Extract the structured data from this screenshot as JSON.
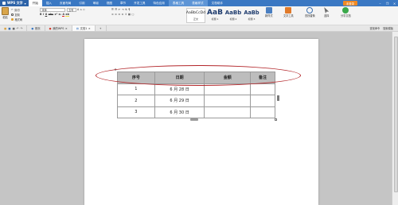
{
  "app": {
    "name": "WPS 文字"
  },
  "menu": {
    "tabs": [
      "开始",
      "插入",
      "页面布局",
      "引用",
      "审阅",
      "视图",
      "章节",
      "开发工具",
      "特色应用"
    ],
    "contextual_tabs": [
      "表格工具",
      "表格样式"
    ],
    "extra_tab": "文档助手",
    "upgrade_label": "未登录"
  },
  "ribbon": {
    "paste_label": "粘贴",
    "cut_label": "剪切",
    "copy_label": "复制",
    "format_painter_label": "格式刷",
    "font_name": "宋体",
    "font_size": "五号",
    "styles": [
      {
        "preview": "AaBbCcDd",
        "label": "正文"
      },
      {
        "preview": "AaB",
        "label": "标题 1"
      },
      {
        "preview": "AaBb",
        "label": "标题 2"
      },
      {
        "preview": "AaBb",
        "label": "标题 3"
      }
    ],
    "new_style_label": "新样式",
    "text_tools_label": "文字工具",
    "find_replace_label": "查找替换",
    "select_label": "选择",
    "share_label": "分享文档"
  },
  "doc_tabs": {
    "tabs": [
      {
        "label": "首页"
      },
      {
        "label": "我的WPS"
      },
      {
        "label": "文档1"
      }
    ],
    "right_labels": [
      "查找命令",
      "搜索模板"
    ]
  },
  "table": {
    "headers": [
      "序号",
      "日期",
      "金额",
      "备注"
    ],
    "rows": [
      [
        "1",
        "6 月 28 日",
        "",
        ""
      ],
      [
        "2",
        "6 月 29 日",
        "",
        ""
      ],
      [
        "3",
        "6 月 30 日",
        "",
        ""
      ]
    ]
  },
  "colors": {
    "title_bar": "#3a78c3",
    "header_fill": "#bdbdbd",
    "annotation": "#b3262a",
    "upgrade": "#f08a24"
  }
}
